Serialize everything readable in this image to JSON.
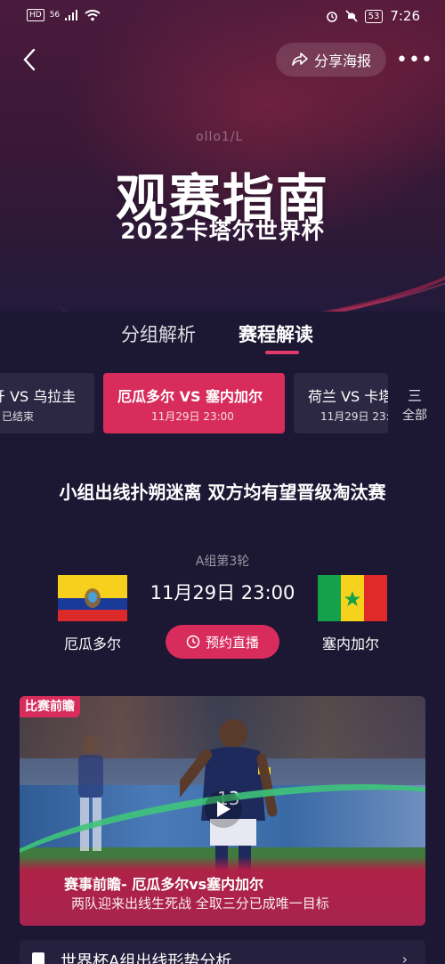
{
  "status_bar": {
    "left": [
      "HD",
      "56",
      "signal",
      "wifi"
    ],
    "battery": "53",
    "time": "7:26"
  },
  "header": {
    "share_label": "分享海报",
    "more_label": "•••"
  },
  "hero": {
    "watermark": "ollo1/L",
    "title": "观赛指南",
    "subtitle": "2022卡塔尔世界杯"
  },
  "tabs": [
    {
      "label": "分组解析",
      "active": false
    },
    {
      "label": "赛程解读",
      "active": true
    }
  ],
  "matches": [
    {
      "title": "牙 VS 乌拉圭",
      "sub": "已结束",
      "active": false
    },
    {
      "title": "厄瓜多尔 VS 塞内加尔",
      "sub": "11月29日 23:00",
      "active": true
    },
    {
      "title": "荷兰 VS 卡塔",
      "sub": "11月29日 23:",
      "active": false
    }
  ],
  "all_label": "全部",
  "all_icon": "三",
  "match_detail": {
    "headline": "小组出线扑朔迷离 双方均有望晋级淘汰赛",
    "round": "A组第3轮",
    "time": "11月29日 23:00",
    "home_team": "厄瓜多尔",
    "away_team": "塞内加尔",
    "reserve_label": "预约直播"
  },
  "video": {
    "tag": "比赛前瞻",
    "title": "赛事前瞻- 厄瓜多尔vs塞内加尔",
    "desc": "两队迎来出线生死战 全取三分已成唯一目标",
    "jersey": "13"
  },
  "bottom_item": {
    "label": "世界杯A组出线形势分析"
  },
  "colors": {
    "accent": "#d72c5c",
    "background": "#1c1733"
  }
}
